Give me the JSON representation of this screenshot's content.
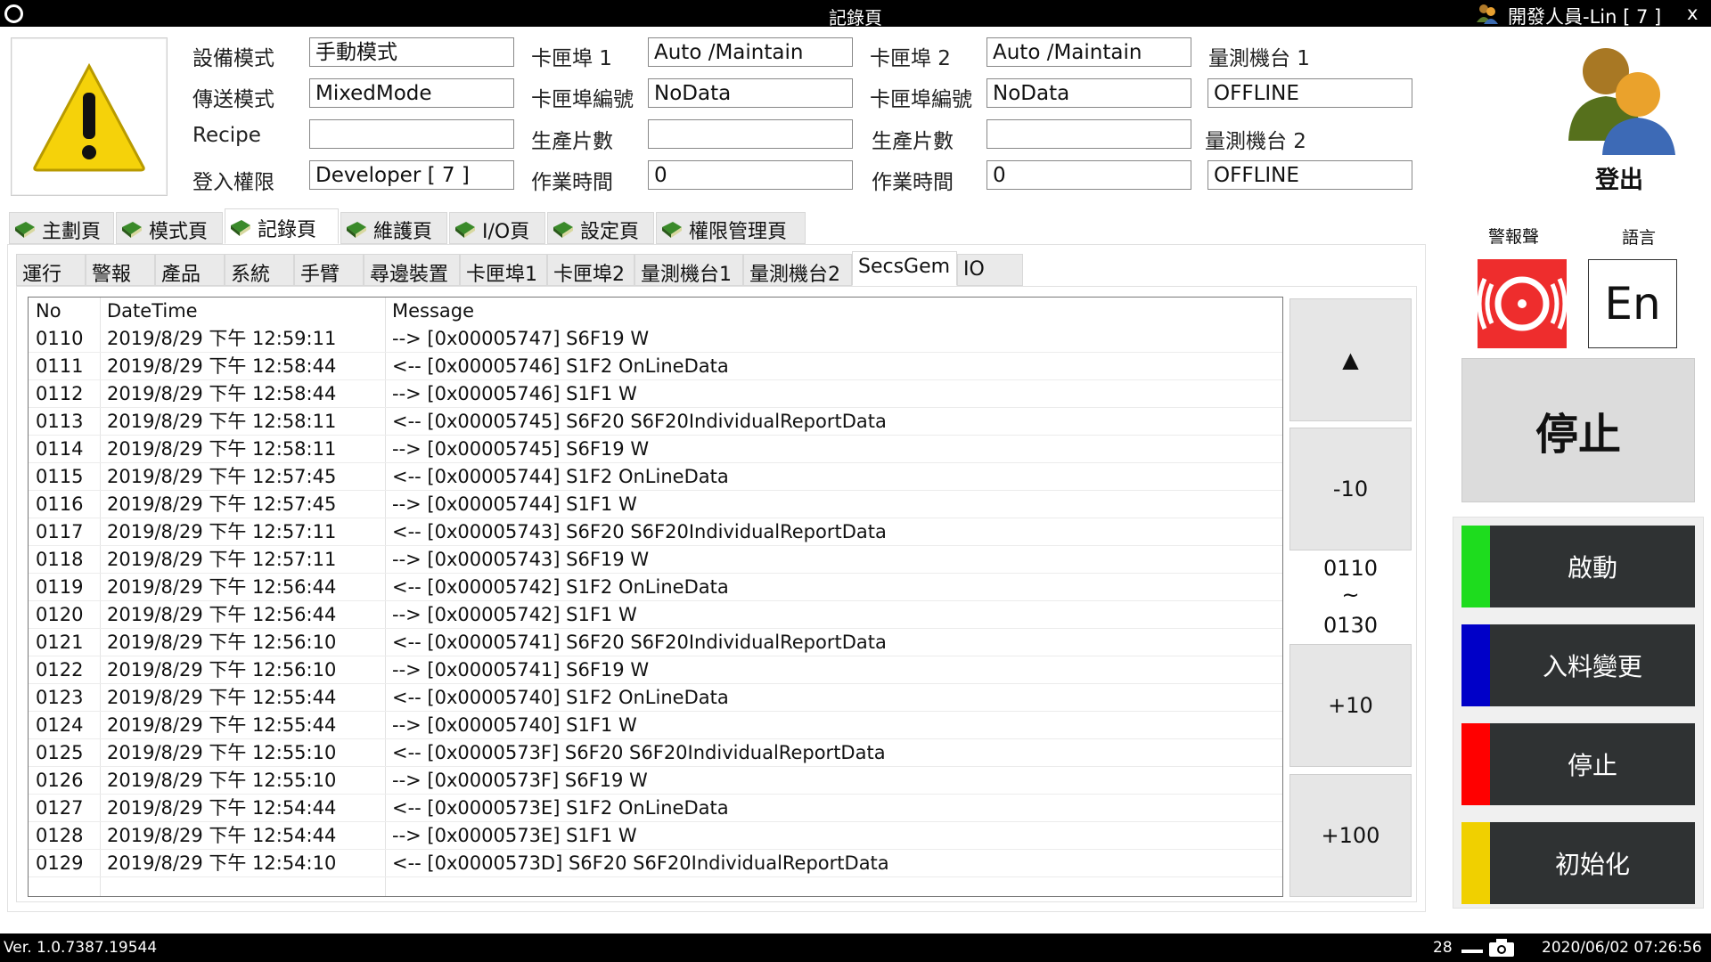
{
  "window": {
    "title": "記錄頁",
    "user": "開發人員-Lin [ 7 ]",
    "close": "x"
  },
  "info": {
    "device_mode_label": "設備模式",
    "device_mode_value": "手動模式",
    "transfer_mode_label": "傳送模式",
    "transfer_mode_value": "MixedMode",
    "recipe_label": "Recipe",
    "recipe_value": "",
    "login_level_label": "登入權限",
    "login_level_value": "Developer [ 7 ]",
    "port1_label": "卡匣埠 1",
    "port1_value": "Auto /Maintain",
    "port1_id_label": "卡匣埠編號",
    "port1_id_value": "NoData",
    "port1_count_label": "生產片數",
    "port1_count_value": "",
    "port1_time_label": "作業時間",
    "port1_time_value": "0",
    "port2_label": "卡匣埠 2",
    "port2_value": "Auto /Maintain",
    "port2_id_label": "卡匣埠編號",
    "port2_id_value": "NoData",
    "port2_count_label": "生產片數",
    "port2_count_value": "",
    "port2_time_label": "作業時間",
    "port2_time_value": "0",
    "meas1_label": "量測機台 1",
    "meas1_value": "OFFLINE",
    "meas2_label": "量測機台 2",
    "meas2_value": "OFFLINE",
    "logout_label": "登出"
  },
  "main_tabs": [
    "主劃頁",
    "模式頁",
    "記錄頁",
    "維護頁",
    "I/O頁",
    "設定頁",
    "權限管理頁"
  ],
  "sub_tabs": [
    "運行",
    "警報",
    "產品",
    "系統",
    "手臂",
    "尋邊裝置",
    "卡匣埠1",
    "卡匣埠2",
    "量測機台1",
    "量測機台2",
    "SecsGem",
    "IO"
  ],
  "log": {
    "headers": {
      "no": "No",
      "datetime": "DateTime",
      "message": "Message"
    },
    "rows": [
      {
        "no": "0110",
        "dt": "2019/8/29 下午 12:59:11",
        "msg": "--> [0x00005747] S6F19 W"
      },
      {
        "no": "0111",
        "dt": "2019/8/29 下午 12:58:44",
        "msg": "<-- [0x00005746] S1F2  OnLineData"
      },
      {
        "no": "0112",
        "dt": "2019/8/29 下午 12:58:44",
        "msg": "--> [0x00005746] S1F1 W"
      },
      {
        "no": "0113",
        "dt": "2019/8/29 下午 12:58:11",
        "msg": "<-- [0x00005745] S6F20  S6F20IndividualReportData"
      },
      {
        "no": "0114",
        "dt": "2019/8/29 下午 12:58:11",
        "msg": "--> [0x00005745] S6F19 W"
      },
      {
        "no": "0115",
        "dt": "2019/8/29 下午 12:57:45",
        "msg": "<-- [0x00005744] S1F2  OnLineData"
      },
      {
        "no": "0116",
        "dt": "2019/8/29 下午 12:57:45",
        "msg": "--> [0x00005744] S1F1 W"
      },
      {
        "no": "0117",
        "dt": "2019/8/29 下午 12:57:11",
        "msg": "<-- [0x00005743] S6F20  S6F20IndividualReportData"
      },
      {
        "no": "0118",
        "dt": "2019/8/29 下午 12:57:11",
        "msg": "--> [0x00005743] S6F19 W"
      },
      {
        "no": "0119",
        "dt": "2019/8/29 下午 12:56:44",
        "msg": "<-- [0x00005742] S1F2  OnLineData"
      },
      {
        "no": "0120",
        "dt": "2019/8/29 下午 12:56:44",
        "msg": "--> [0x00005742] S1F1 W"
      },
      {
        "no": "0121",
        "dt": "2019/8/29 下午 12:56:10",
        "msg": "<-- [0x00005741] S6F20  S6F20IndividualReportData"
      },
      {
        "no": "0122",
        "dt": "2019/8/29 下午 12:56:10",
        "msg": "--> [0x00005741] S6F19 W"
      },
      {
        "no": "0123",
        "dt": "2019/8/29 下午 12:55:44",
        "msg": "<-- [0x00005740] S1F2  OnLineData"
      },
      {
        "no": "0124",
        "dt": "2019/8/29 下午 12:55:44",
        "msg": "--> [0x00005740] S1F1 W"
      },
      {
        "no": "0125",
        "dt": "2019/8/29 下午 12:55:10",
        "msg": "<-- [0x0000573F] S6F20  S6F20IndividualReportData"
      },
      {
        "no": "0126",
        "dt": "2019/8/29 下午 12:55:10",
        "msg": "--> [0x0000573F] S6F19 W"
      },
      {
        "no": "0127",
        "dt": "2019/8/29 下午 12:54:44",
        "msg": "<-- [0x0000573E] S1F2  OnLineData"
      },
      {
        "no": "0128",
        "dt": "2019/8/29 下午 12:54:44",
        "msg": "--> [0x0000573E] S1F1 W"
      },
      {
        "no": "0129",
        "dt": "2019/8/29 下午 12:54:10",
        "msg": "<-- [0x0000573D] S6F20  S6F20IndividualReportData"
      }
    ]
  },
  "nav": {
    "up": "▲",
    "minus10": "-10",
    "range_start": "0110",
    "range_sep": "~",
    "range_end": "0130",
    "plus10": "+10",
    "plus100": "+100"
  },
  "right": {
    "alarm_label": "警報聲",
    "language_label": "語言",
    "language_value": "En",
    "stop_big": "停止",
    "start": "啟動",
    "feed_change": "入料變更",
    "stop": "停止",
    "init": "初始化",
    "colors": {
      "start": "#1edc1e",
      "feed_change": "#0000c8",
      "stop": "#ff0000",
      "init": "#f0d000",
      "alarm": "#ee2d2d"
    }
  },
  "status": {
    "version": "Ver. 1.0.7387.19544",
    "count": "28",
    "datetime": "2020/06/02 07:26:56"
  }
}
